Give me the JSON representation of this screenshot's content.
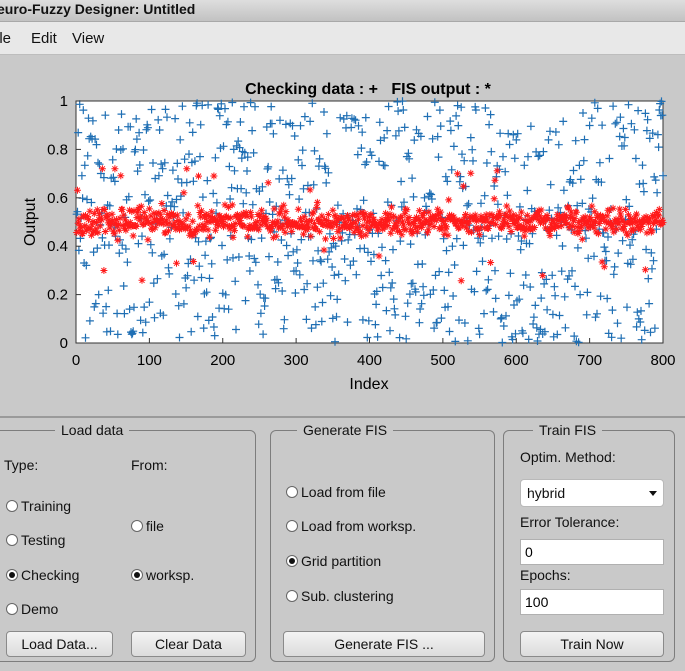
{
  "window": {
    "title": "euro-Fuzzy Designer: Untitled"
  },
  "menu": {
    "items": [
      "ile",
      "Edit",
      "View"
    ]
  },
  "chart_data": {
    "type": "scatter",
    "title": "Checking data : +   FIS output : *",
    "xlabel": "Index",
    "ylabel": "Output",
    "xlim": [
      0,
      800
    ],
    "ylim": [
      0,
      1
    ],
    "xticks": [
      0,
      100,
      200,
      300,
      400,
      500,
      600,
      700,
      800
    ],
    "yticks": [
      0,
      0.2,
      0.4,
      0.6,
      0.8,
      1
    ],
    "series": [
      {
        "name": "Checking data",
        "marker": "+",
        "color": "#1f6fb4",
        "n_points": 800,
        "y_distribution": "uniform 0-1"
      },
      {
        "name": "FIS output",
        "marker": "*",
        "color": "#ff1a1a",
        "n_points": 800,
        "y_distribution": "centered ~0.5, range ~0.17-0.72"
      }
    ],
    "grid": false
  },
  "load_data": {
    "title": "Load data",
    "type_label": "Type:",
    "from_label": "From:",
    "types": [
      {
        "label": "Training",
        "selected": false
      },
      {
        "label": "Testing",
        "selected": false
      },
      {
        "label": "Checking",
        "selected": true
      },
      {
        "label": "Demo",
        "selected": false
      }
    ],
    "sources": [
      {
        "label": "file",
        "selected": false
      },
      {
        "label": "worksp.",
        "selected": true
      }
    ],
    "load_button": "Load Data...",
    "clear_button": "Clear Data"
  },
  "generate_fis": {
    "title": "Generate FIS",
    "options": [
      {
        "label": "Load from file",
        "selected": false
      },
      {
        "label": "Load from worksp.",
        "selected": false
      },
      {
        "label": "Grid partition",
        "selected": true
      },
      {
        "label": "Sub. clustering",
        "selected": false
      }
    ],
    "button": "Generate FIS ..."
  },
  "train_fis": {
    "title": "Train FIS",
    "method_label": "Optim. Method:",
    "method_value": "hybrid",
    "tolerance_label": "Error Tolerance:",
    "tolerance_value": "0",
    "epochs_label": "Epochs:",
    "epochs_value": "100",
    "button": "Train Now"
  }
}
